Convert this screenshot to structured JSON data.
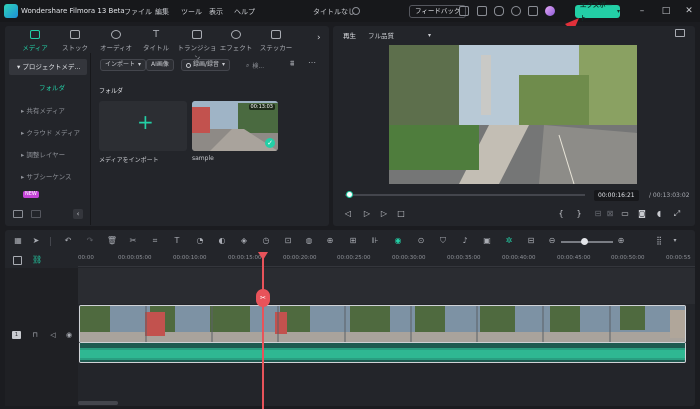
{
  "titlebar": {
    "app_title": "Wondershare Filmora 13 Beta",
    "menu": [
      "ファイル",
      "編集",
      "ツール",
      "表示",
      "ヘルプ"
    ],
    "doc_title": "タイトルなし",
    "feedback_label": "フィードバック",
    "export_label": "エクスポート"
  },
  "media_tabs": [
    "メディア",
    "ストック",
    "オーディオ",
    "タイトル",
    "トランジション",
    "エフェクト",
    "ステッカー"
  ],
  "sidebar": {
    "project_media": "プロジェクトメデ...",
    "folder": "フォルダ",
    "items": [
      "共有メディア",
      "クラウド メディア",
      "調整レイヤー",
      "サブシーケンス"
    ],
    "new_badge": "NEW"
  },
  "media_toolbar": {
    "import_label": "インポート",
    "ai_image_label": "AI画像",
    "record_label": "録画/録音",
    "search_placeholder": "検..."
  },
  "media_area": {
    "folder_label": "フォルダ",
    "import_media_label": "メディアをインポート",
    "sample_name": "sample",
    "sample_duration": "00:13:03"
  },
  "preview": {
    "play_label": "再生",
    "quality_label": "フル品質",
    "current_time": "00:00:16:21",
    "total_time": "/ 00:13:03:02"
  },
  "timeline": {
    "ticks": [
      "00:00",
      "00:00:05:00",
      "00:00:10:00",
      "00:00:15:00",
      "00:00:20:00",
      "00:00:25:00",
      "00:00:30:00",
      "00:00:35:00",
      "00:00:40:00",
      "00:00:45:00",
      "00:00:50:00",
      "00:00:55"
    ]
  },
  "colors": {
    "accent": "#23cfa6",
    "playhead": "#e8535a",
    "annotation_arrow": "#e0303a"
  }
}
